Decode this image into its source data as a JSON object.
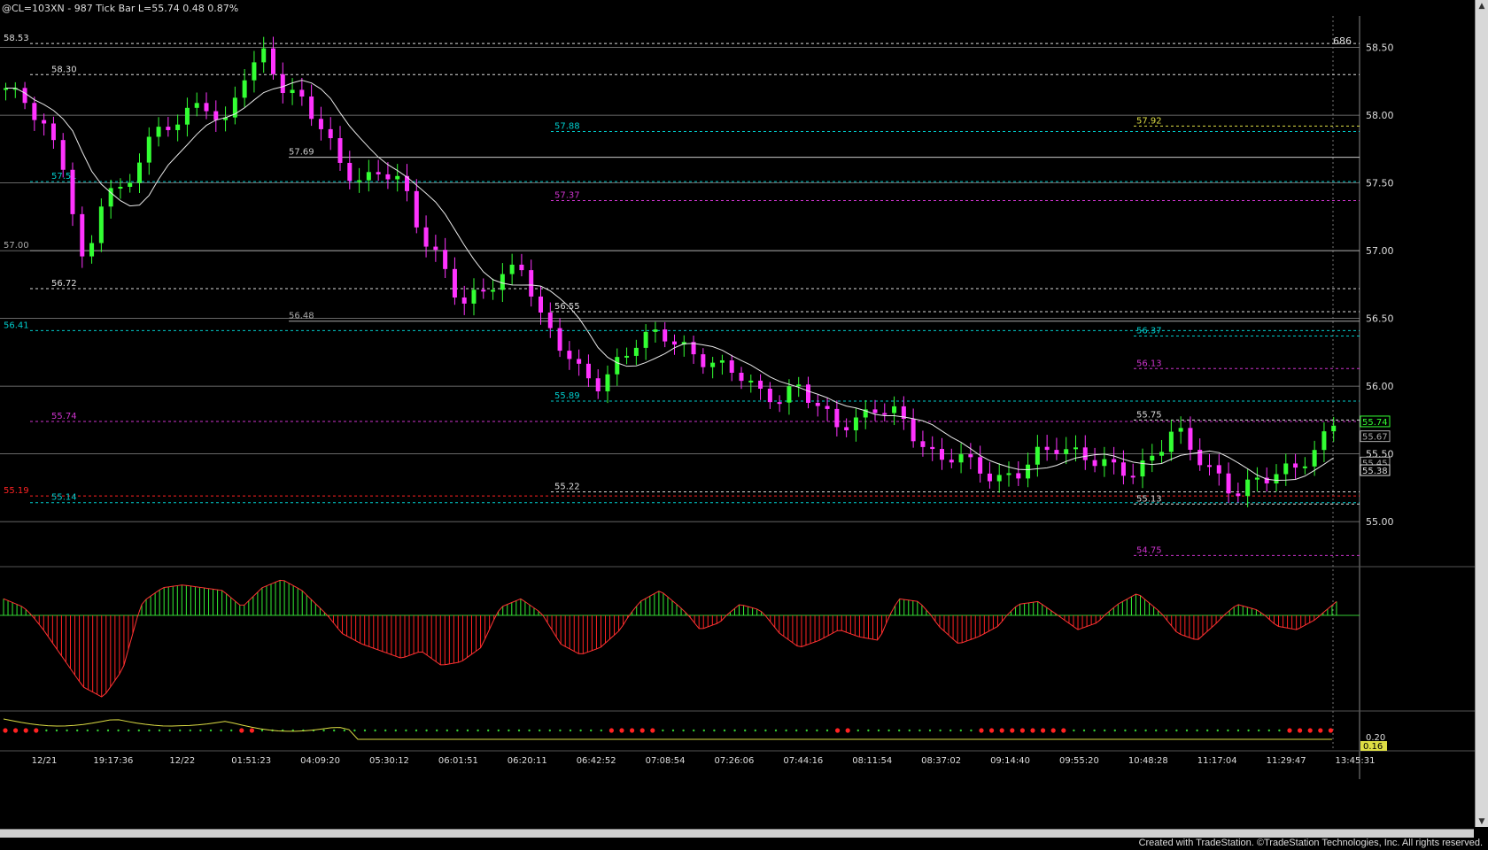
{
  "header": {
    "title": "@CL=103XN - 987 Tick Bar  L=55.74  0.48  0.87%",
    "bar_count": "686"
  },
  "footer": {
    "credit": "Created with TradeStation. ©TradeStation Technologies, Inc. All rights reserved."
  },
  "colors": {
    "background": "#000000",
    "up_bar": "#33ff33",
    "down_bar": "#ff33ff",
    "grid": "#a0a0a0",
    "cyan": "#00cccc",
    "magenta": "#cc33cc",
    "yellow": "#dddd44",
    "red": "#ff2222"
  },
  "chart_data": {
    "type": "candlestick",
    "ylim": [
      54.72,
      58.72
    ],
    "y_ticks": [
      "58.50",
      "58.00",
      "57.50",
      "57.00",
      "56.50",
      "56.00",
      "55.50",
      "55.00"
    ],
    "x_tick_labels": [
      "12/21",
      "19:17:36",
      "12/22",
      "01:51:23",
      "04:09:20",
      "05:30:12",
      "06:01:51",
      "06:20:11",
      "06:42:52",
      "07:08:54",
      "07:26:06",
      "07:44:16",
      "08:11:54",
      "08:37:02",
      "09:14:40",
      "09:55:20",
      "10:48:28",
      "11:17:04",
      "11:29:47",
      "13:45:31"
    ],
    "last_price_markers": [
      "55.74",
      "55.67",
      "55.45",
      "55.38"
    ],
    "close_path": [
      58.2,
      58.1,
      57.9,
      57.6,
      56.8,
      57.5,
      57.4,
      57.8,
      57.9,
      58.0,
      58.1,
      57.9,
      58.3,
      58.45,
      58.2,
      58.1,
      57.9,
      57.6,
      57.5,
      57.6,
      57.5,
      57.1,
      56.9,
      56.6,
      56.7,
      56.8,
      56.9,
      56.5,
      56.3,
      56.1,
      56.0,
      56.2,
      56.35,
      56.4,
      56.3,
      56.2,
      56.15,
      56.1,
      55.95,
      55.9,
      56.0,
      55.85,
      55.7,
      55.75,
      55.85,
      55.8,
      55.6,
      55.45,
      55.5,
      55.4,
      55.3,
      55.35,
      55.5,
      55.55,
      55.5,
      55.45,
      55.4,
      55.35,
      55.5,
      55.7,
      55.5,
      55.35,
      55.2,
      55.3,
      55.35,
      55.4,
      55.5,
      55.74
    ],
    "levels": [
      {
        "label": "58.53",
        "value": 58.53,
        "color": "#dddddd",
        "dash": true,
        "side": "left"
      },
      {
        "label": "58.30",
        "value": 58.3,
        "color": "#dddddd",
        "dash": true,
        "side": "left2"
      },
      {
        "label": "57.88",
        "value": 57.88,
        "color": "#00cccc",
        "dash": true,
        "side": "mid"
      },
      {
        "label": "57.92",
        "value": 57.92,
        "color": "#dddd44",
        "dash": true,
        "side": "right"
      },
      {
        "label": "57.69",
        "value": 57.69,
        "color": "#cccccc",
        "dash": false,
        "side": "mid0"
      },
      {
        "label": "57.51",
        "value": 57.51,
        "color": "#00cccc",
        "dash": true,
        "side": "left2"
      },
      {
        "label": "57.37",
        "value": 57.37,
        "color": "#cc33cc",
        "dash": true,
        "side": "mid"
      },
      {
        "label": "57.00",
        "value": 57.0,
        "color": "#aaaaaa",
        "dash": false,
        "side": "left"
      },
      {
        "label": "56.72",
        "value": 56.72,
        "color": "#dddddd",
        "dash": true,
        "side": "left2"
      },
      {
        "label": "56.55",
        "value": 56.55,
        "color": "#dddddd",
        "dash": true,
        "side": "mid"
      },
      {
        "label": "56.48",
        "value": 56.48,
        "color": "#aaaaaa",
        "dash": false,
        "side": "mid0"
      },
      {
        "label": "56.41",
        "value": 56.41,
        "color": "#00cccc",
        "dash": true,
        "side": "left"
      },
      {
        "label": "56.37",
        "value": 56.37,
        "color": "#00cccc",
        "dash": true,
        "side": "right"
      },
      {
        "label": "56.13",
        "value": 56.13,
        "color": "#cc33cc",
        "dash": true,
        "side": "right"
      },
      {
        "label": "55.89",
        "value": 55.89,
        "color": "#00cccc",
        "dash": true,
        "side": "mid"
      },
      {
        "label": "55.75",
        "value": 55.75,
        "color": "#dddddd",
        "dash": true,
        "side": "right"
      },
      {
        "label": "55.74",
        "value": 55.74,
        "color": "#cc33cc",
        "dash": true,
        "side": "left2"
      },
      {
        "label": "55.22",
        "value": 55.22,
        "color": "#dddddd",
        "dash": true,
        "side": "mid"
      },
      {
        "label": "55.19",
        "value": 55.19,
        "color": "#ff2222",
        "dash": true,
        "side": "left"
      },
      {
        "label": "55.14",
        "value": 55.14,
        "color": "#00cccc",
        "dash": true,
        "side": "left2"
      },
      {
        "label": "55.13",
        "value": 55.13,
        "color": "#dddddd",
        "dash": true,
        "side": "right"
      },
      {
        "label": "54.75",
        "value": 54.75,
        "color": "#cc33cc",
        "dash": true,
        "side": "right"
      }
    ],
    "oscillator": {
      "zero_line_color": "#33cc33",
      "values": [
        0.6,
        0.3,
        -0.4,
        -1.2,
        -2.0,
        -2.3,
        -1.5,
        0.5,
        1.0,
        1.1,
        1.0,
        0.9,
        0.3,
        1.0,
        1.3,
        0.9,
        0.2,
        -0.5,
        -0.8,
        -1.0,
        -1.2,
        -1.0,
        -1.4,
        -1.3,
        -0.9,
        0.3,
        0.6,
        0.1,
        -0.8,
        -1.1,
        -0.9,
        -0.4,
        0.5,
        0.9,
        0.3,
        -0.4,
        -0.2,
        0.4,
        0.2,
        -0.5,
        -0.9,
        -0.7,
        -0.4,
        -0.6,
        -0.7,
        0.6,
        0.5,
        -0.3,
        -0.8,
        -0.6,
        -0.3,
        0.4,
        0.5,
        0.0,
        -0.4,
        -0.2,
        0.4,
        0.8,
        0.2,
        -0.5,
        -0.7,
        -0.2,
        0.4,
        0.2,
        -0.3,
        -0.4,
        -0.1,
        0.5
      ],
      "ylim": [
        -2.6,
        1.6
      ]
    },
    "lower_panel": {
      "y_ticks": [
        "0.20"
      ],
      "last_value": "0.16"
    },
    "annotations": [
      "686"
    ]
  }
}
